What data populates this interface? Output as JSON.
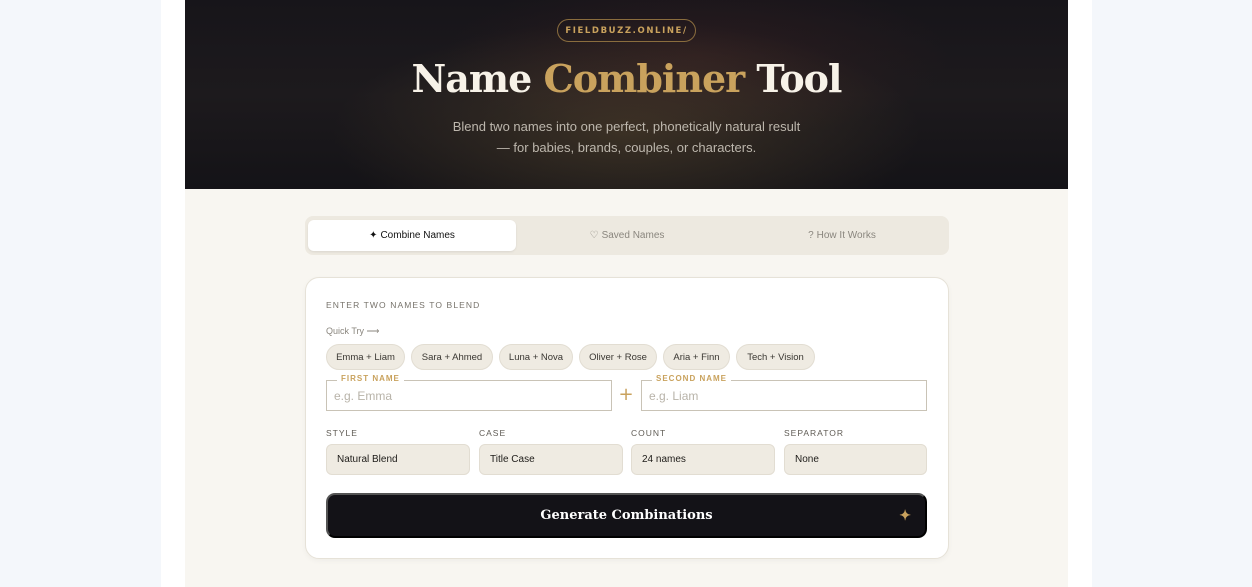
{
  "hero": {
    "domain_badge": "FIELDBUZZ.ONLINE/",
    "title_part1": "Name ",
    "title_accent": "Combiner",
    "title_part2": " Tool",
    "subtitle_line1": "Blend two names into one perfect, phonetically natural result",
    "subtitle_line2": "— for babies, brands, couples, or characters."
  },
  "tabs": [
    {
      "icon": "✦",
      "label": "Combine Names",
      "active": true
    },
    {
      "icon": "♡",
      "label": "Saved Names",
      "active": false
    },
    {
      "icon": "?",
      "label": "How It Works",
      "active": false
    }
  ],
  "form": {
    "section_label": "ENTER TWO NAMES TO BLEND",
    "quick_try_label": "Quick Try ⟶",
    "quick_try": [
      "Emma + Liam",
      "Sara + Ahmed",
      "Luna + Nova",
      "Oliver + Rose",
      "Aria + Finn",
      "Tech + Vision"
    ],
    "first_name": {
      "label": "FIRST NAME",
      "placeholder": "e.g. Emma",
      "value": ""
    },
    "second_name": {
      "label": "SECOND NAME",
      "placeholder": "e.g. Liam",
      "value": ""
    },
    "plus_symbol": "+",
    "options": [
      {
        "label": "STYLE",
        "value": "Natural Blend"
      },
      {
        "label": "CASE",
        "value": "Title Case"
      },
      {
        "label": "COUNT",
        "value": "24 names"
      },
      {
        "label": "SEPARATOR",
        "value": "None"
      }
    ],
    "generate_label": "Generate Combinations",
    "generate_icon": "✦"
  },
  "colors": {
    "accent": "#c9a25d",
    "hero_bg": "#17151a",
    "button_bg": "#131217"
  }
}
